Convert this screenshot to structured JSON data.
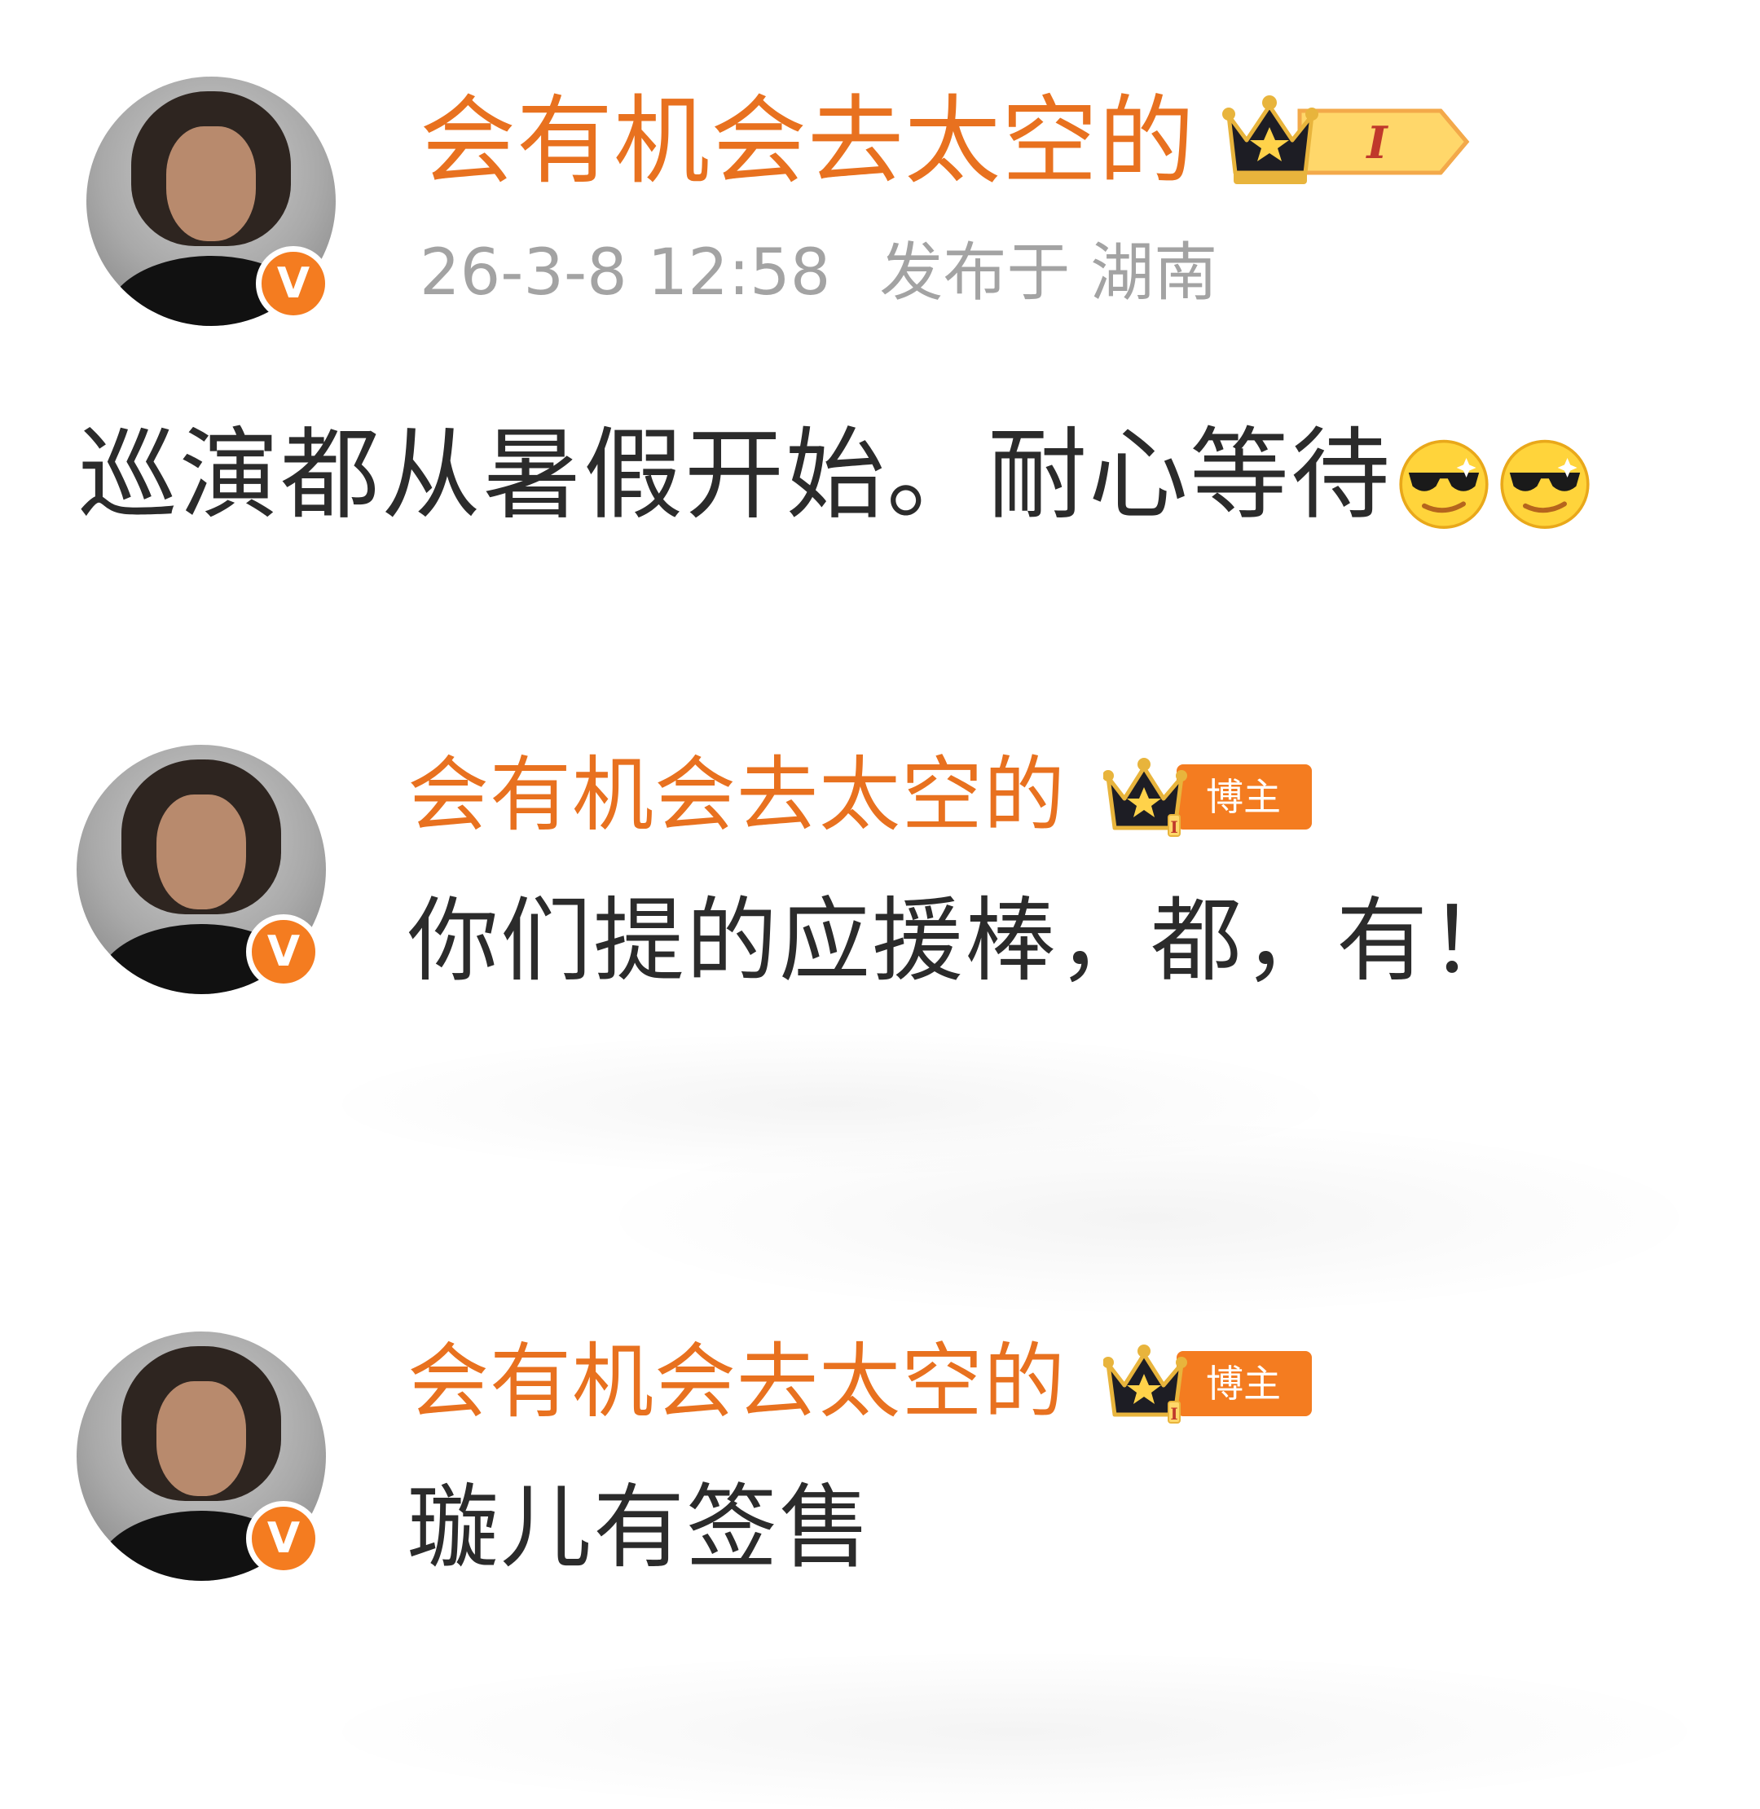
{
  "post": {
    "author": "会有机会去太空的",
    "level_badge": "I",
    "timestamp": "26-3-8 12:58",
    "location": "发布于 湖南",
    "text": "巡演都从暑假开始。耐心等待",
    "emojis": [
      "sunglasses-emoji",
      "sunglasses-emoji"
    ],
    "verified_mark": "V"
  },
  "replies": [
    {
      "author": "会有机会去太空的",
      "role_badge": "博主",
      "level_badge": "I",
      "text": "你们提的应援棒，都，有！",
      "verified_mark": "V"
    },
    {
      "author": "会有机会去太空的",
      "role_badge": "博主",
      "level_badge": "I",
      "text": "璇儿有签售",
      "verified_mark": "V"
    }
  ],
  "colors": {
    "name": "#e8711f",
    "verified": "#f47c20",
    "meta": "#a3a3a3",
    "body": "#2b2b2b"
  }
}
